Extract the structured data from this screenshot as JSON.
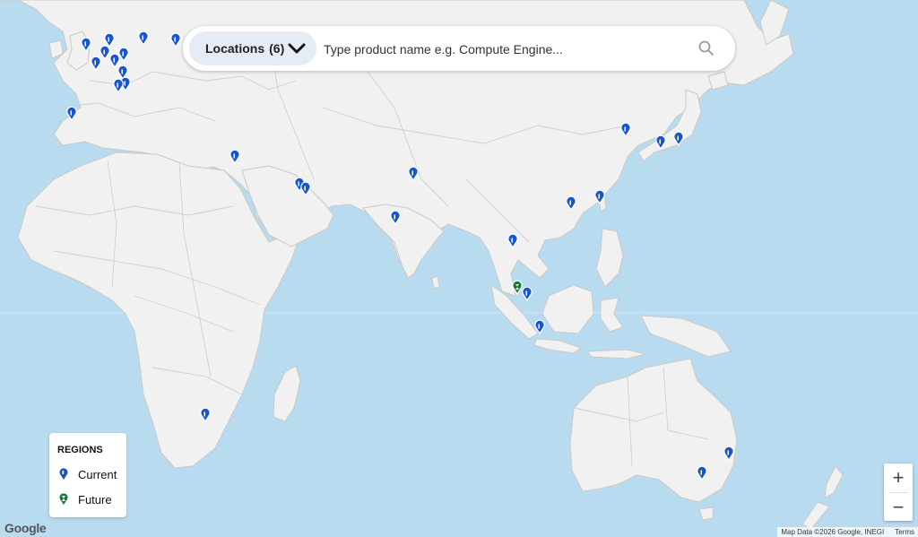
{
  "search": {
    "locations_label": "Locations",
    "locations_count": "(6)",
    "placeholder": "Type product name e.g. Compute Engine..."
  },
  "legend": {
    "title": "REGIONS",
    "items": [
      {
        "label": "Current",
        "color": "#1a56c8"
      },
      {
        "label": "Future",
        "color": "#1e7a3a"
      }
    ]
  },
  "zoom": {
    "in": "+",
    "out": "−"
  },
  "attribution": {
    "logo": "Google",
    "data": "Map Data ©2026 Google, INEGI",
    "terms": "Terms"
  },
  "colors": {
    "water": "#b9dbf0",
    "land": "#f1f1f1",
    "current_pin": "#1a56c8",
    "future_pin": "#1e7a3a"
  },
  "icons": [
    "search-icon",
    "chevron-down-icon",
    "map-pin-icon"
  ],
  "pins": [
    {
      "type": "current",
      "region": "Ireland"
    },
    {
      "type": "current",
      "region": "United Kingdom"
    },
    {
      "type": "current",
      "region": "Netherlands"
    },
    {
      "type": "current",
      "region": "Belgium"
    },
    {
      "type": "current",
      "region": "Germany"
    },
    {
      "type": "current",
      "region": "Poland"
    },
    {
      "type": "current",
      "region": "Finland"
    },
    {
      "type": "current",
      "region": "Sweden"
    },
    {
      "type": "current",
      "region": "France"
    },
    {
      "type": "current",
      "region": "Switzerland"
    },
    {
      "type": "current",
      "region": "Italy"
    },
    {
      "type": "current",
      "region": "Spain"
    },
    {
      "type": "current",
      "region": "Israel"
    },
    {
      "type": "current",
      "region": "Qatar"
    },
    {
      "type": "current",
      "region": "Saudi Arabia"
    },
    {
      "type": "current",
      "region": "North India"
    },
    {
      "type": "current",
      "region": "West India"
    },
    {
      "type": "current",
      "region": "Thailand"
    },
    {
      "type": "future",
      "region": "Malaysia"
    },
    {
      "type": "current",
      "region": "Singapore"
    },
    {
      "type": "current",
      "region": "Indonesia"
    },
    {
      "type": "current",
      "region": "Hong Kong"
    },
    {
      "type": "current",
      "region": "Taiwan"
    },
    {
      "type": "current",
      "region": "South Korea"
    },
    {
      "type": "current",
      "region": "Osaka"
    },
    {
      "type": "current",
      "region": "Tokyo"
    },
    {
      "type": "current",
      "region": "South Africa"
    },
    {
      "type": "current",
      "region": "Sydney"
    },
    {
      "type": "current",
      "region": "Melbourne"
    }
  ]
}
